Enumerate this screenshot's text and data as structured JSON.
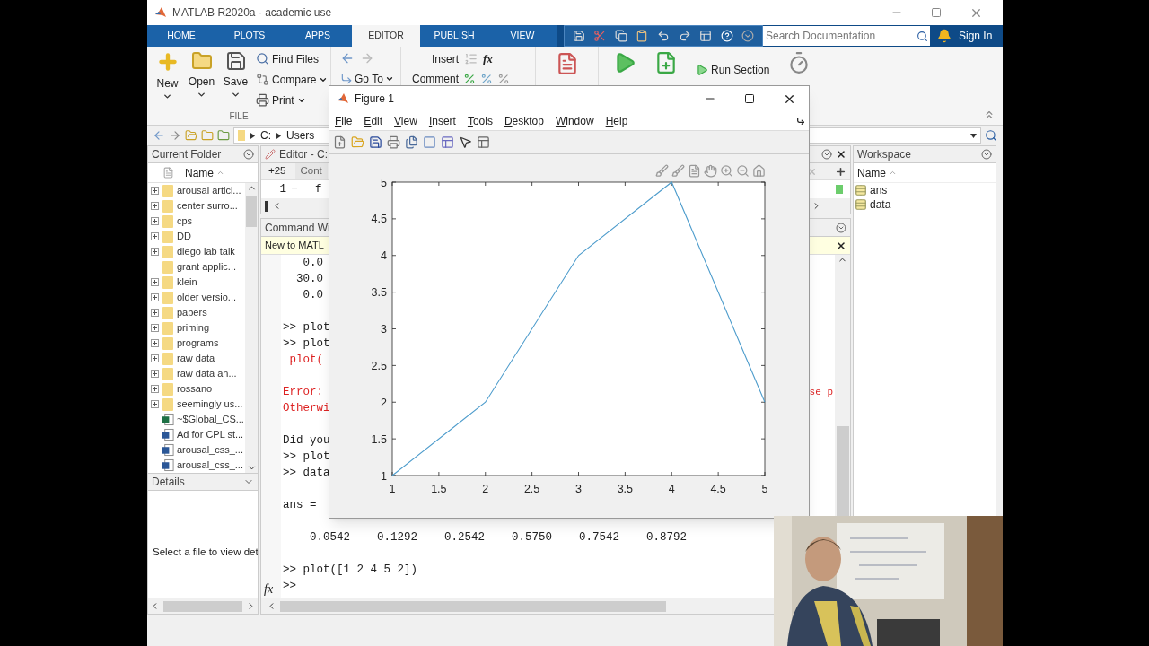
{
  "window": {
    "title": "MATLAB R2020a - academic use"
  },
  "ribbon_tabs": [
    {
      "label": "HOME",
      "selected": false
    },
    {
      "label": "PLOTS",
      "selected": false
    },
    {
      "label": "APPS",
      "selected": false
    },
    {
      "label": "EDITOR",
      "selected": true
    },
    {
      "label": "PUBLISH",
      "selected": false
    },
    {
      "label": "VIEW",
      "selected": false
    }
  ],
  "search": {
    "placeholder": "Search Documentation"
  },
  "sign_in": "Sign In",
  "ribbon": {
    "big_buttons": [
      "New",
      "Open",
      "Save"
    ],
    "small_buttons": [
      "Find Files",
      "Compare",
      "Print"
    ],
    "file_label": "FILE",
    "go_to": "Go To",
    "insert": "Insert",
    "fx": "fx",
    "comment": "Comment",
    "run_section": "Run Section"
  },
  "address_bar": {
    "path": [
      "C:",
      "Users"
    ]
  },
  "current_folder": {
    "title": "Current Folder",
    "column": "Name",
    "items": [
      {
        "name": "arousal articl...",
        "kind": "folder",
        "expandable": true
      },
      {
        "name": "center surro...",
        "kind": "folder",
        "expandable": true
      },
      {
        "name": "cps",
        "kind": "folder",
        "expandable": true
      },
      {
        "name": "DD",
        "kind": "folder",
        "expandable": true
      },
      {
        "name": "diego lab talk",
        "kind": "folder",
        "expandable": true
      },
      {
        "name": "grant applic...",
        "kind": "folder",
        "expandable": false
      },
      {
        "name": "klein",
        "kind": "folder",
        "expandable": true
      },
      {
        "name": "older versio...",
        "kind": "folder",
        "expandable": true
      },
      {
        "name": "papers",
        "kind": "folder",
        "expandable": true
      },
      {
        "name": "priming",
        "kind": "folder",
        "expandable": true
      },
      {
        "name": "programs",
        "kind": "folder",
        "expandable": true
      },
      {
        "name": "raw data",
        "kind": "folder",
        "expandable": true
      },
      {
        "name": "raw data an...",
        "kind": "folder",
        "expandable": true
      },
      {
        "name": "rossano",
        "kind": "folder",
        "expandable": true
      },
      {
        "name": "seemingly us...",
        "kind": "folder",
        "expandable": true
      },
      {
        "name": "~$Global_CS...",
        "kind": "excel",
        "expandable": false
      },
      {
        "name": "Ad for CPL st...",
        "kind": "word",
        "expandable": false
      },
      {
        "name": "arousal_css_...",
        "kind": "word",
        "expandable": false
      },
      {
        "name": "arousal_css_...",
        "kind": "word",
        "expandable": false
      }
    ]
  },
  "details": {
    "title": "Details",
    "message": "Select a file to view det"
  },
  "editor": {
    "title": "Editor - C:",
    "tabs": [
      "+25",
      "Cont"
    ],
    "line_number": "1",
    "line_marker": "−",
    "line_text": "f"
  },
  "command_window": {
    "title": "Command Wi",
    "banner": "New to MATL",
    "lines": [
      {
        "kind": "output",
        "text": "   0.0"
      },
      {
        "kind": "output",
        "text": "  30.0"
      },
      {
        "kind": "output",
        "text": "   0.0"
      },
      {
        "kind": "blank"
      },
      {
        "kind": "output",
        "text": ">> plot"
      },
      {
        "kind": "output",
        "text": ">> plot"
      },
      {
        "kind": "error",
        "text": " plot("
      },
      {
        "kind": "blank"
      },
      {
        "kind": "error",
        "text": "Error:",
        "tail": "se p"
      },
      {
        "kind": "error",
        "text": "Otherwi"
      },
      {
        "kind": "blank"
      },
      {
        "kind": "output",
        "text": "Did you"
      },
      {
        "kind": "output",
        "text": ">> plot"
      },
      {
        "kind": "output",
        "text": ">> data"
      },
      {
        "kind": "blank"
      },
      {
        "kind": "output",
        "text": "ans ="
      },
      {
        "kind": "blank"
      },
      {
        "kind": "output",
        "text": "    0.0542    0.1292    0.2542    0.5750    0.7542    0.8792"
      },
      {
        "kind": "blank"
      },
      {
        "kind": "output",
        "text": ">> plot([1 2 4 5 2])"
      }
    ],
    "prompt_icon": "fx",
    "prompt": ">>"
  },
  "workspace": {
    "title": "Workspace",
    "column": "Name",
    "variables": [
      "ans",
      "data"
    ]
  },
  "figure": {
    "title": "Figure 1",
    "menu": [
      "File",
      "Edit",
      "View",
      "Insert",
      "Tools",
      "Desktop",
      "Window",
      "Help"
    ],
    "chart_data": {
      "type": "line",
      "x": [
        1,
        2,
        3,
        4,
        5
      ],
      "series": [
        {
          "color": "#4d9ccc",
          "values": [
            1,
            2,
            4,
            5,
            2
          ]
        }
      ],
      "xlim": [
        1,
        5
      ],
      "ylim": [
        1,
        5
      ],
      "xticks": [
        1,
        1.5,
        2,
        2.5,
        3,
        3.5,
        4,
        4.5,
        5
      ],
      "yticks": [
        1,
        1.5,
        2,
        2.5,
        3,
        3.5,
        4,
        4.5,
        5
      ]
    }
  }
}
